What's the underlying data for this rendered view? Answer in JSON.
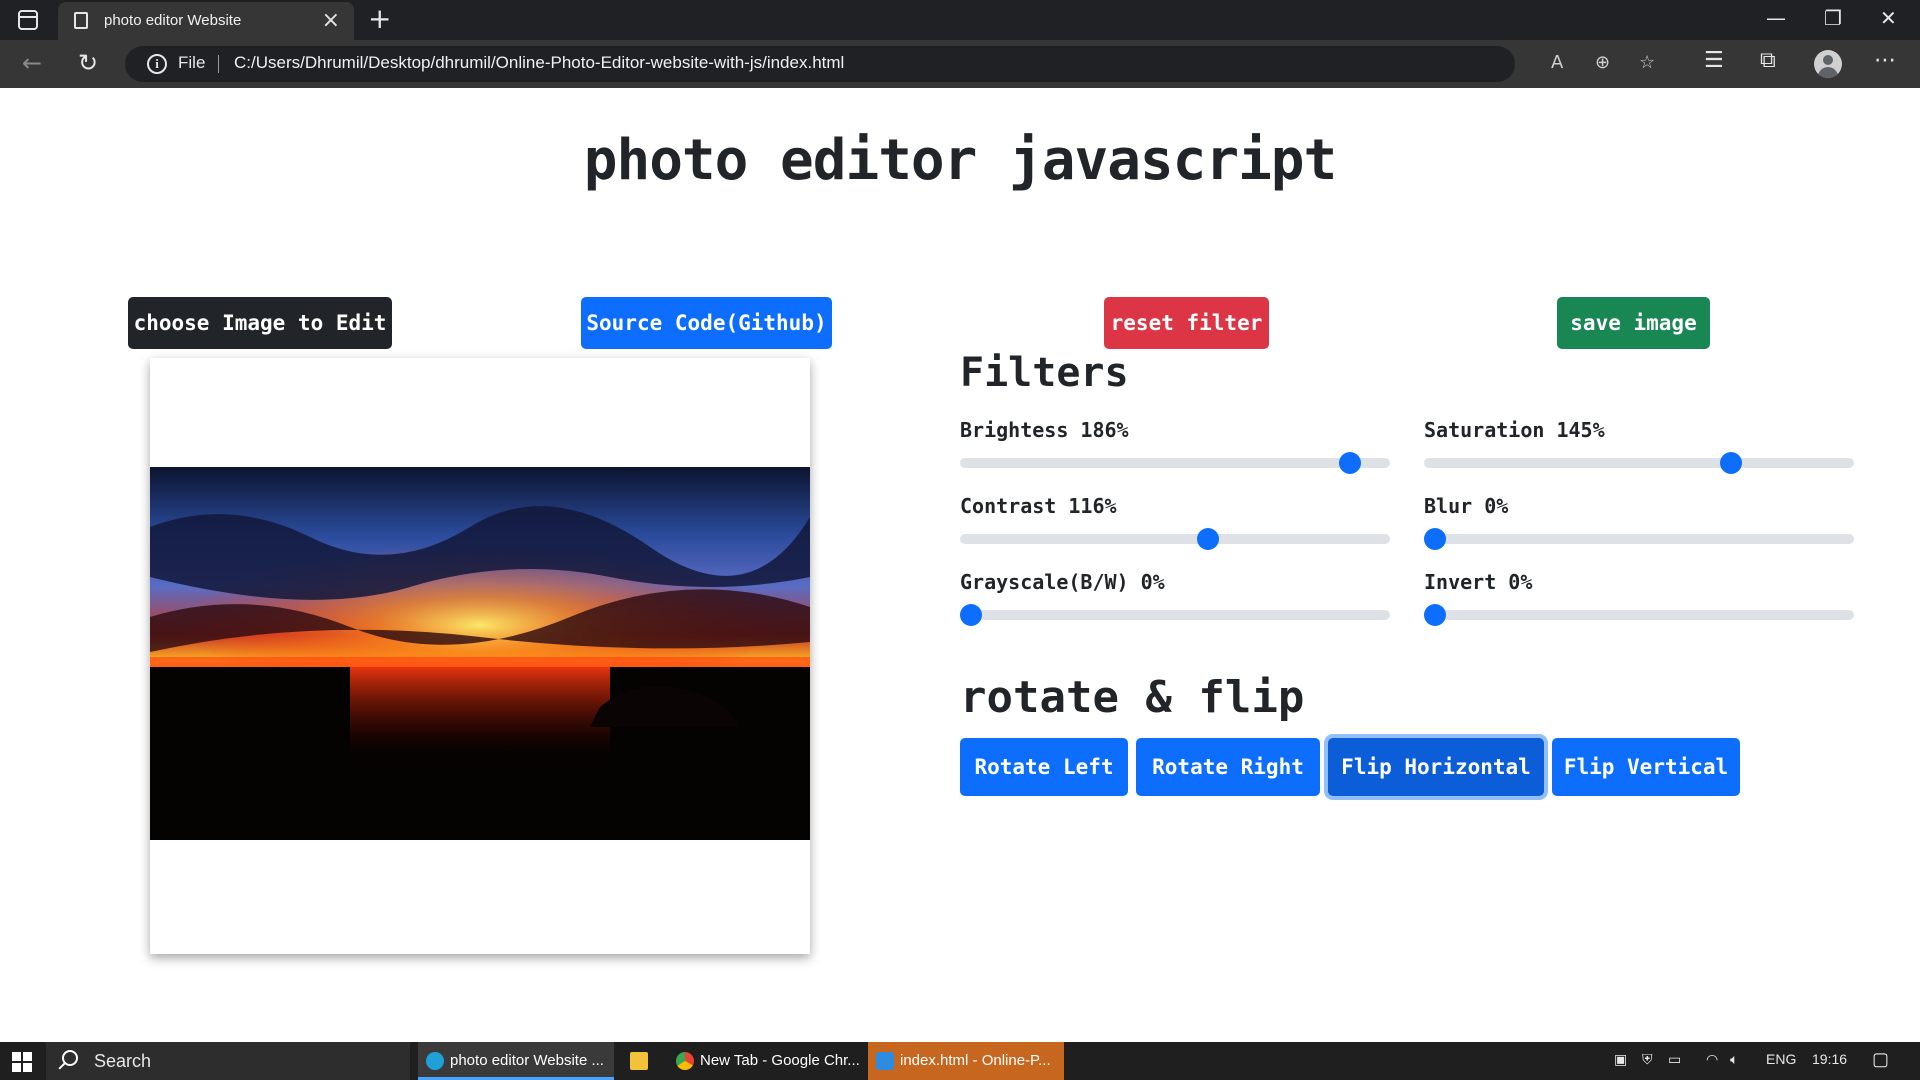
{
  "browser": {
    "tab_title": "photo editor Website",
    "address_scheme": "File",
    "url": "C:/Users/Dhrumil/Desktop/dhrumil/Online-Photo-Editor-website-with-js/index.html"
  },
  "page": {
    "title": "photo editor javascript",
    "buttons": {
      "choose": "choose Image to Edit",
      "source": "Source Code(Github)",
      "reset": "reset filter",
      "save": "save image"
    },
    "filters_heading": "Filters",
    "filters": [
      {
        "label": "Brightess 186%",
        "value": 186,
        "min": 0,
        "max": 200
      },
      {
        "label": "Saturation 145%",
        "value": 145,
        "min": 0,
        "max": 200
      },
      {
        "label": "Contrast 116%",
        "value": 116,
        "min": 0,
        "max": 200
      },
      {
        "label": "Blur 0%",
        "value": 0,
        "min": 0,
        "max": 100
      },
      {
        "label": "Grayscale(B/W) 0%",
        "value": 0,
        "min": 0,
        "max": 100
      },
      {
        "label": "Invert 0%",
        "value": 0,
        "min": 0,
        "max": 100
      }
    ],
    "rotate_heading": "rotate & flip",
    "rotate_buttons": [
      "Rotate Left",
      "Rotate Right",
      "Flip Horizontal",
      "Flip Vertical"
    ],
    "active_rotate_button": "Flip Horizontal"
  },
  "taskbar": {
    "search_label": "Search",
    "apps": [
      {
        "label": "photo editor Website ...",
        "icon": "edge-icon"
      },
      {
        "label": "",
        "icon": "file-explorer-icon"
      },
      {
        "label": "New Tab - Google Chr...",
        "icon": "chrome-icon"
      },
      {
        "label": "index.html - Online-P...",
        "icon": "vscode-icon"
      }
    ],
    "language": "ENG",
    "time": "19:16"
  },
  "colors": {
    "primary": "#0d6efd",
    "danger": "#dc3545",
    "success": "#198754",
    "dark": "#212529"
  }
}
